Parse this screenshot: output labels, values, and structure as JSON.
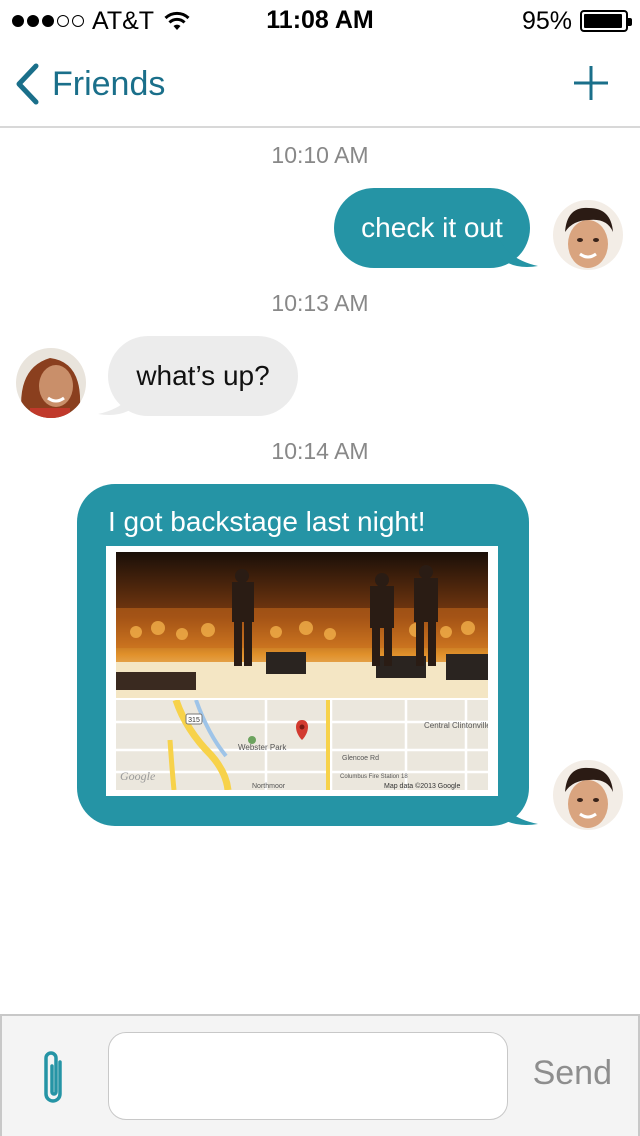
{
  "status_bar": {
    "signal_bars": 3,
    "signal_total": 5,
    "carrier": "AT&T",
    "wifi_icon": "wifi-icon",
    "time": "11:08 AM",
    "battery_percent": "95%",
    "battery_level": 0.95
  },
  "nav": {
    "back_label": "Friends",
    "back_icon": "chevron-left-icon",
    "add_icon": "plus-icon",
    "accent_color": "#1a6f8a"
  },
  "conversation": {
    "bubble_out_color": "#2594a5",
    "bubble_in_color": "#ececec",
    "messages": [
      {
        "timestamp": "10:10 AM",
        "direction": "outgoing",
        "text": "check it out"
      },
      {
        "timestamp": "10:13 AM",
        "direction": "incoming",
        "text": "what’s up?"
      },
      {
        "timestamp": "10:14 AM",
        "direction": "outgoing",
        "text": "I got backstage last night!",
        "attachment": {
          "photo": "concert-stage-photo",
          "map": {
            "labels": [
              "Central Clintonville",
              "Webster Park",
              "Glencoe Rd",
              "Northmoor",
              "Columbus Fire Station 18",
              "315"
            ],
            "attribution": "Map data ©2013 Google",
            "logo": "Google"
          }
        }
      }
    ]
  },
  "composer": {
    "attach_icon": "paperclip-icon",
    "input_value": "",
    "input_placeholder": "",
    "send_label": "Send"
  }
}
